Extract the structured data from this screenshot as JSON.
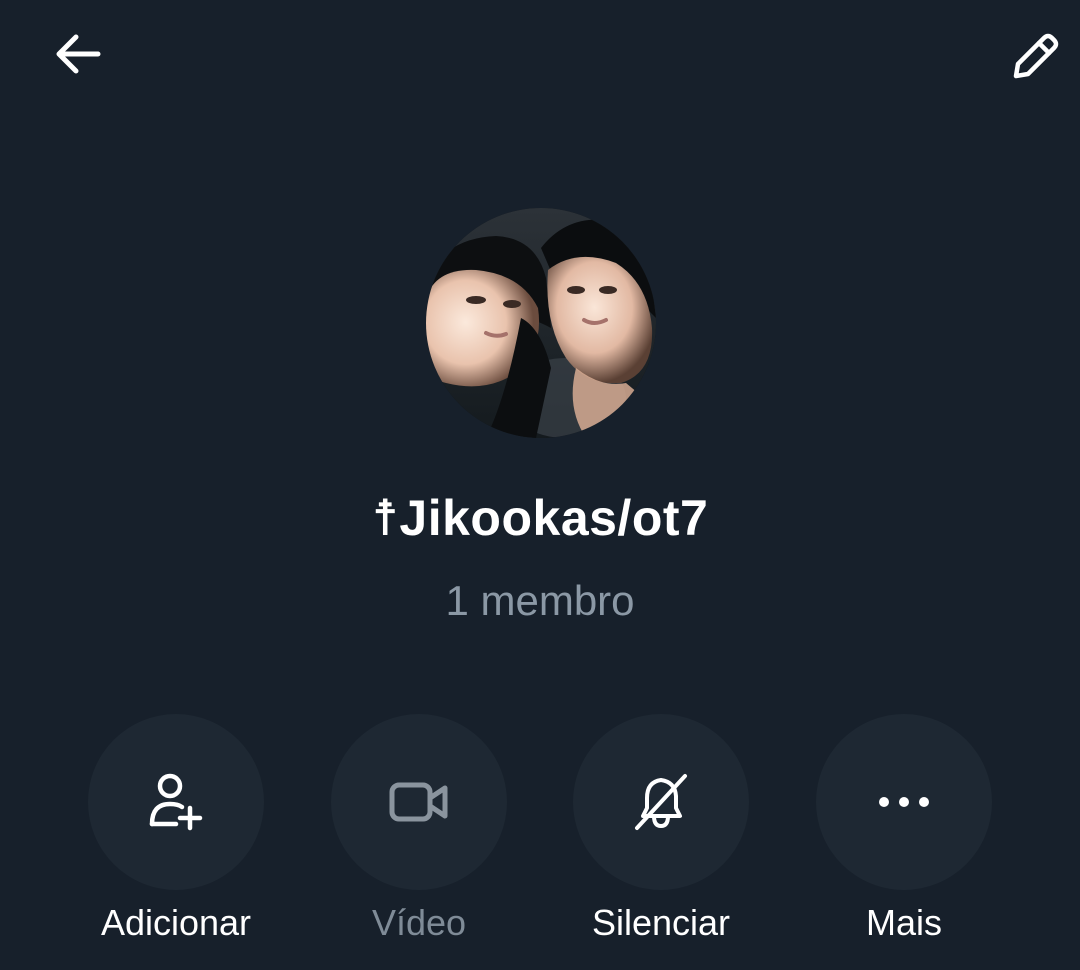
{
  "header": {
    "back_icon": "arrow-left-icon",
    "edit_icon": "pencil-icon"
  },
  "group": {
    "name": "☨Jikookas/ot7",
    "members": "1 membro"
  },
  "actions": [
    {
      "label": "Adicionar",
      "icon": "add-person-icon",
      "enabled": true
    },
    {
      "label": "Vídeo",
      "icon": "video-camera-icon",
      "enabled": false
    },
    {
      "label": "Silenciar",
      "icon": "bell-off-icon",
      "enabled": true
    },
    {
      "label": "Mais",
      "icon": "more-dots-icon",
      "enabled": true
    }
  ],
  "colors": {
    "background": "#17202b",
    "button_bg": "#1e2833",
    "text_primary": "#ffffff",
    "text_secondary": "#8b98a5",
    "disabled": "#7f8b97"
  }
}
